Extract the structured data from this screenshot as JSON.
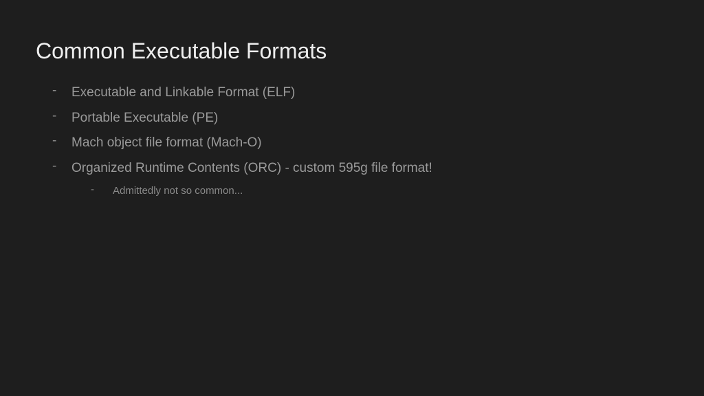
{
  "slide": {
    "title": "Common Executable Formats",
    "bullets": [
      {
        "text": "Executable and Linkable Format (ELF)"
      },
      {
        "text": "Portable Executable (PE)"
      },
      {
        "text": "Mach object file format (Mach-O)"
      },
      {
        "text": "Organized Runtime Contents (ORC) - custom 595g file format!"
      }
    ],
    "subBullets": [
      {
        "text": "Admittedly not so common..."
      }
    ]
  }
}
